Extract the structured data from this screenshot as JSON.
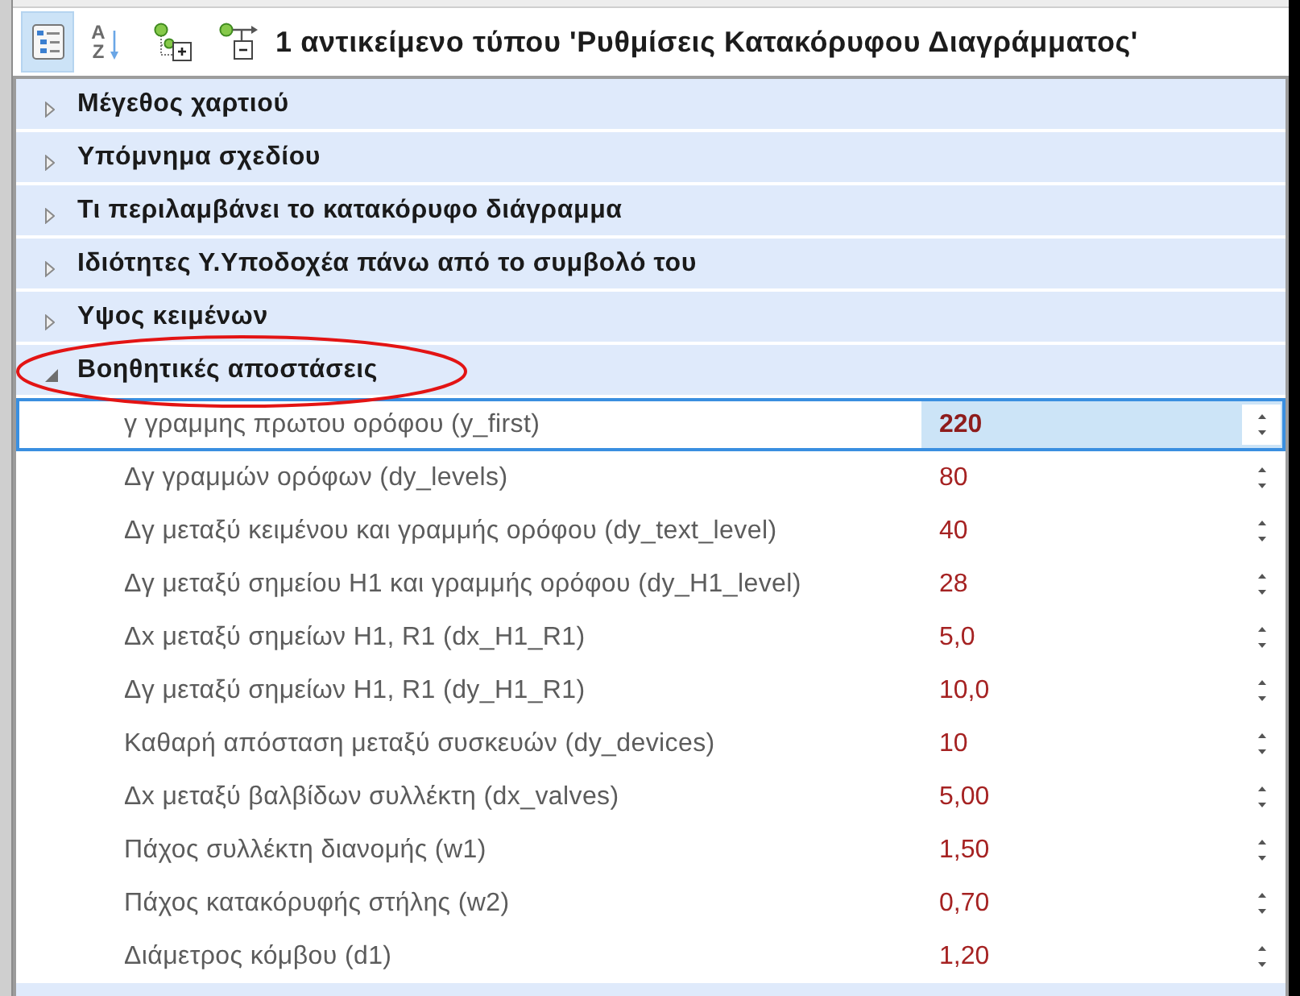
{
  "toolbar": {
    "view_modes": [
      {
        "kind": "categorized",
        "selected": true
      },
      {
        "kind": "alphabetical",
        "selected": false,
        "glyphs": [
          "A",
          "Z"
        ]
      }
    ],
    "actions": [
      {
        "kind": "property_pages"
      },
      {
        "kind": "collapse"
      }
    ],
    "title": "1 αντικείμενο τύπου 'Ρυθμίσεις Κατακόρυφου Διαγράμματος'"
  },
  "property_grid": {
    "categories": [
      {
        "label": "Μέγεθος χαρτιού",
        "expanded": false,
        "circled": false
      },
      {
        "label": "Υπόμνημα σχεδίου",
        "expanded": false,
        "circled": false
      },
      {
        "label": "Τι περιλαμβάνει το κατακόρυφο διάγραμμα",
        "expanded": false,
        "circled": false
      },
      {
        "label": "Ιδιότητες Υ.Υποδοχέα πάνω από το συμβολό του",
        "expanded": false,
        "circled": false
      },
      {
        "label": "Υψος κειμένων",
        "expanded": false,
        "circled": false
      },
      {
        "label": "Βοηθητικές αποστάσεις",
        "expanded": true,
        "circled": true,
        "properties": [
          {
            "label": "γ γραμμης πρωτου ορόφου (y_first)",
            "value": "220",
            "selected": true
          },
          {
            "label": "Δγ γραμμών ορόφων (dy_levels)",
            "value": "80",
            "selected": false
          },
          {
            "label": "Δγ μεταξύ κειμένου και γραμμής ορόφου (dy_text_level)",
            "value": "40",
            "selected": false
          },
          {
            "label": "Δγ μεταξύ σημείου H1 και γραμμής ορόφου (dy_H1_level)",
            "value": "28",
            "selected": false
          },
          {
            "label": "Δx μεταξύ σημείων H1, R1 (dx_H1_R1)",
            "value": "5,0",
            "selected": false
          },
          {
            "label": "Δγ μεταξύ σημείων H1, R1 (dy_H1_R1)",
            "value": "10,0",
            "selected": false
          },
          {
            "label": "Καθαρή απόσταση μεταξύ συσκευών (dy_devices)",
            "value": "10",
            "selected": false
          },
          {
            "label": "Δx μεταξύ βαλβίδων συλλέκτη (dx_valves)",
            "value": "5,00",
            "selected": false
          },
          {
            "label": "Πάχος συλλέκτη διανομής (w1)",
            "value": "1,50",
            "selected": false
          },
          {
            "label": "Πάχος κατακόρυφής στήλης (w2)",
            "value": "0,70",
            "selected": false
          },
          {
            "label": "Διάμετρος κόμβου (d1)",
            "value": "1,20",
            "selected": false
          }
        ]
      }
    ]
  }
}
